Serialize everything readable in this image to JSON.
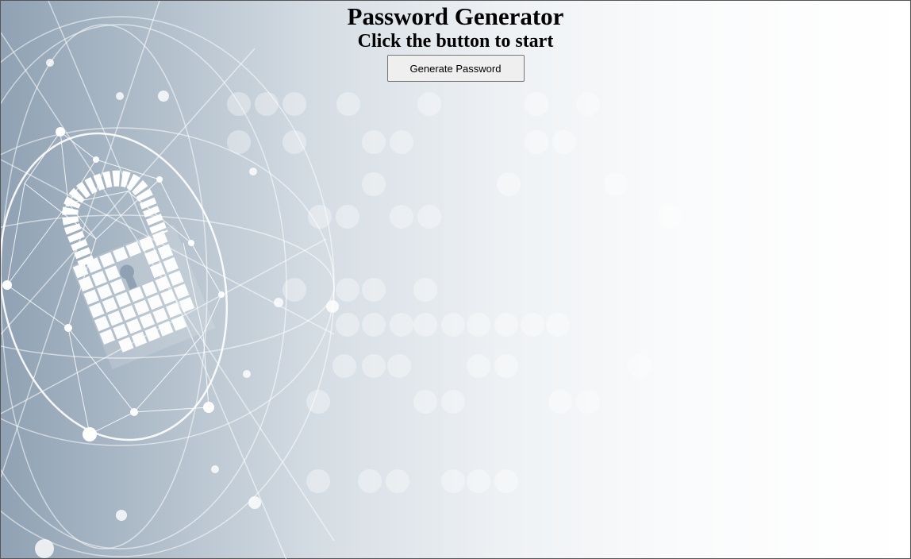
{
  "page": {
    "title": "Password Generator",
    "subtitle": "Click the button to start"
  },
  "actions": {
    "generate_label": "Generate Password"
  },
  "background": {
    "icon": "padlock-network-icon",
    "colors": {
      "left": "#8fa1b3",
      "right": "#ffffff"
    }
  }
}
